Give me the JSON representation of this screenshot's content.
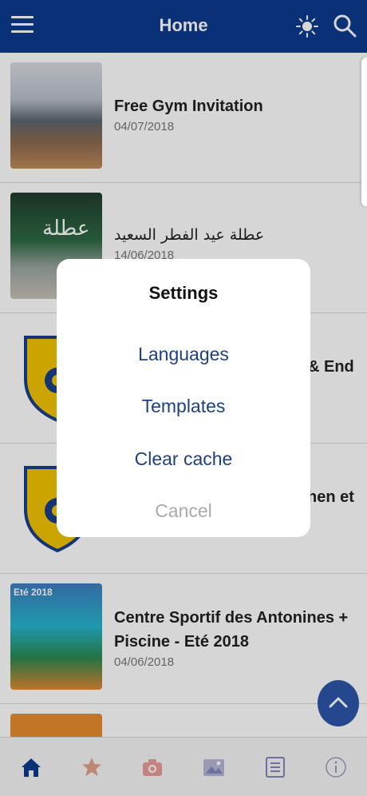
{
  "app": {
    "title": "Home"
  },
  "colors": {
    "brand": "#0d3b8e",
    "accent_blue": "#1c3f86",
    "fab": "#2c55a8",
    "star": "#e2a28a"
  },
  "appbar": {
    "menu_icon": "menu-icon",
    "theme_icon": "sun-icon",
    "search_icon": "search-icon"
  },
  "feed": [
    {
      "title": "Free Gym Invitation",
      "date": "04/07/2018"
    },
    {
      "title": "عطلة عيد الفطر السعيد",
      "date": "14/06/2018"
    },
    {
      "title": "& End",
      "date": ""
    },
    {
      "title": "hen et",
      "date": ""
    },
    {
      "title": "Centre Sportif des Antonines + Piscine - Eté 2018",
      "date": "04/06/2018"
    }
  ],
  "thumb_text": {
    "eid_banner": "عطلة",
    "pool_badge": "Eté 2018"
  },
  "dialog": {
    "title": "Settings",
    "options": [
      "Languages",
      "Templates",
      "Clear cache"
    ],
    "cancel": "Cancel"
  },
  "bottom_nav": [
    "home-icon",
    "star-icon",
    "camera-icon",
    "gallery-icon",
    "list-icon",
    "info-icon"
  ]
}
